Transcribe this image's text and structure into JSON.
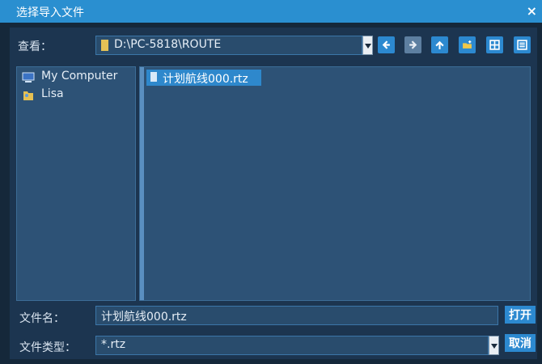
{
  "window": {
    "title": "选择导入文件",
    "close_glyph": "×"
  },
  "look_in": {
    "label": "查看：",
    "path": "D:\\PC-5818\\ROUTE",
    "folder_icon": "folder-icon"
  },
  "toolbar": {
    "buttons": [
      {
        "name": "back-button",
        "icon": "arrow-left-icon"
      },
      {
        "name": "forward-button",
        "icon": "arrow-right-icon"
      },
      {
        "name": "up-button",
        "icon": "arrow-up-icon"
      },
      {
        "name": "new-folder-button",
        "icon": "new-folder-icon"
      },
      {
        "name": "list-view-button",
        "icon": "grid-view-icon"
      },
      {
        "name": "detail-view-button",
        "icon": "detail-view-icon"
      }
    ]
  },
  "places": {
    "items": [
      {
        "label": "My Computer",
        "icon": "computer-icon"
      },
      {
        "label": "Lisa",
        "icon": "user-folder-icon"
      }
    ]
  },
  "files": {
    "items": [
      {
        "label": "计划航线000.rtz",
        "icon": "file-icon",
        "selected": true
      }
    ]
  },
  "file_name": {
    "label": "文件名：",
    "value": "计划航线000.rtz"
  },
  "file_type": {
    "label": "文件类型：",
    "value": "*.rtz"
  },
  "actions": {
    "open_label": "打开",
    "cancel_label": "取消"
  },
  "colors": {
    "accent": "#2c89d0",
    "titlebar": "#2a8fd0",
    "background": "#1c3550",
    "panel": "#2d5276"
  }
}
